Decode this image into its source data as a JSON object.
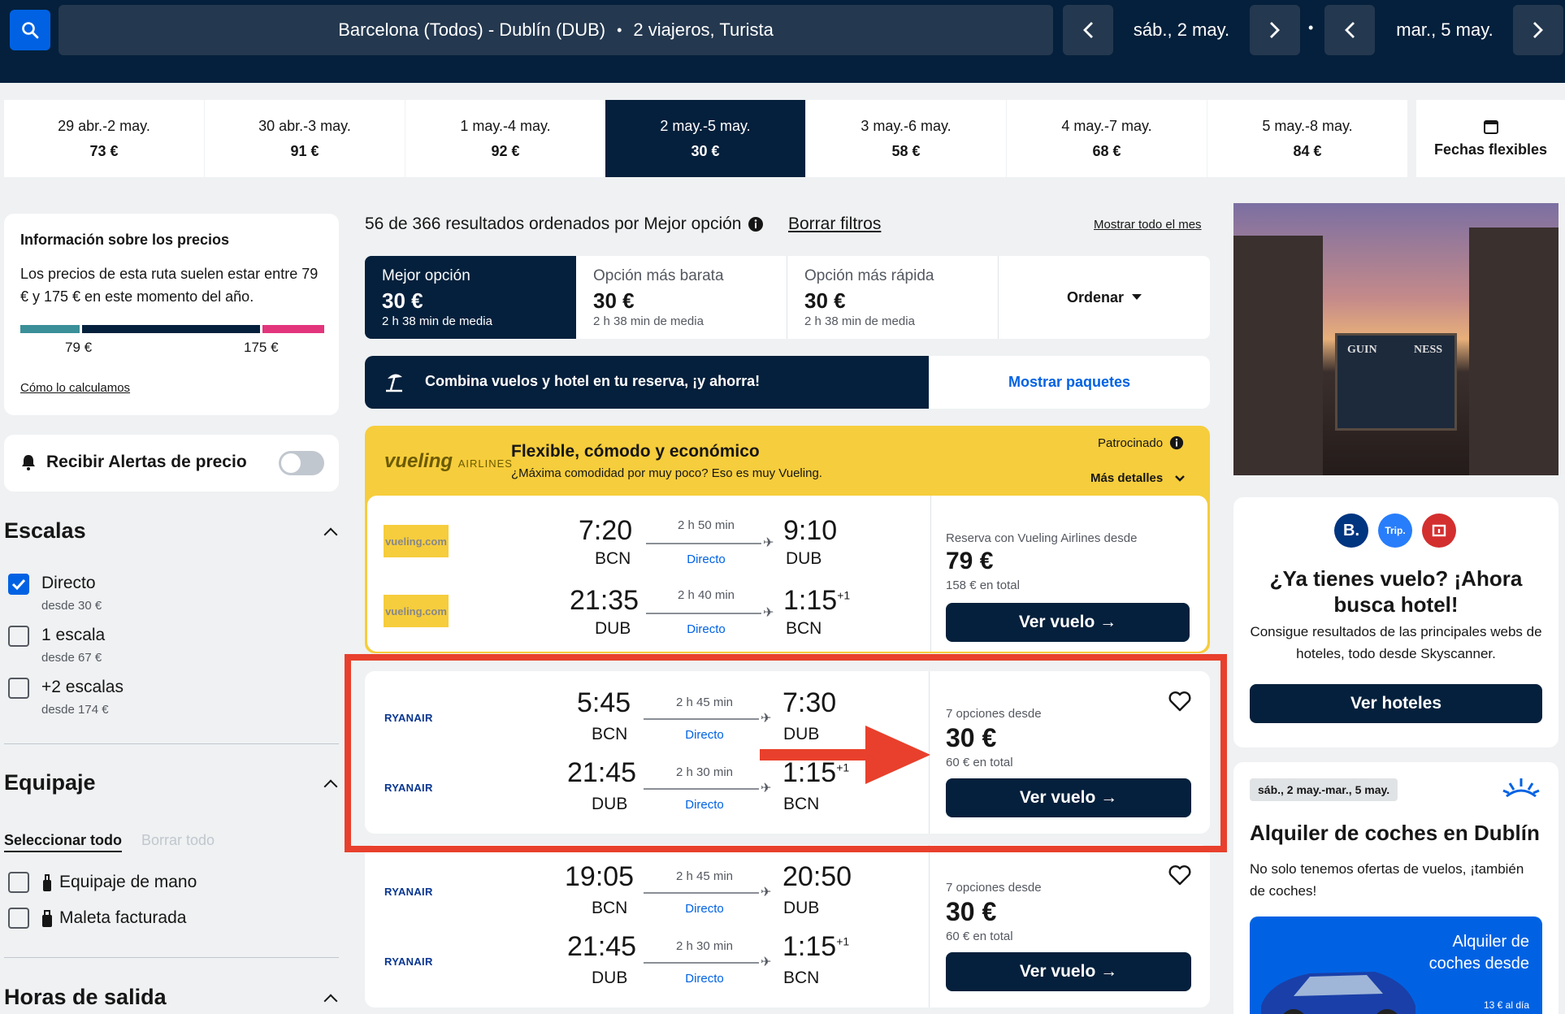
{
  "search": {
    "route": "Barcelona (Todos) - Dublín (DUB)",
    "travellers": "2 viajeros, Turista",
    "depart_date": "sáb., 2 may.",
    "return_date": "mar., 5 may."
  },
  "date_tabs": [
    {
      "range": "29 abr.-2 may.",
      "price": "73 €"
    },
    {
      "range": "30 abr.-3 may.",
      "price": "91 €"
    },
    {
      "range": "1 may.-4 may.",
      "price": "92 €"
    },
    {
      "range": "2 may.-5 may.",
      "price": "30 €"
    },
    {
      "range": "3 may.-6 may.",
      "price": "58 €"
    },
    {
      "range": "4 may.-7 may.",
      "price": "68 €"
    },
    {
      "range": "5 may.-8 may.",
      "price": "84 €"
    }
  ],
  "flexible_dates_label": "Fechas flexibles",
  "price_info": {
    "title": "Información sobre los precios",
    "text": "Los precios de esta ruta suelen estar entre 79 € y 175 € en este momento del año.",
    "low": "79 €",
    "high": "175 €",
    "link": "Cómo lo calculamos"
  },
  "alerts_label": "Recibir Alertas de precio",
  "stops": {
    "title": "Escalas",
    "options": [
      {
        "label": "Directo",
        "sub": "desde 30 €",
        "checked": true
      },
      {
        "label": "1 escala",
        "sub": "desde 67 €",
        "checked": false
      },
      {
        "label": "+2 escalas",
        "sub": "desde 174 €",
        "checked": false
      }
    ]
  },
  "baggage": {
    "title": "Equipaje",
    "select_all": "Seleccionar todo",
    "clear_all": "Borrar todo",
    "options": [
      "Equipaje de mano",
      "Maleta facturada"
    ]
  },
  "departure_times_title": "Horas de salida",
  "results": {
    "summary": "56 de 366 resultados ordenados por Mejor opción",
    "clear_filters": "Borrar filtros",
    "show_month": "Mostrar todo el mes"
  },
  "sort": [
    {
      "title": "Mejor opción",
      "price": "30 €",
      "duration": "2 h 38 min de media"
    },
    {
      "title": "Opción más barata",
      "price": "30 €",
      "duration": "2 h 38 min de media"
    },
    {
      "title": "Opción más rápida",
      "price": "30 €",
      "duration": "2 h 38 min de media"
    }
  ],
  "sort_menu_label": "Ordenar",
  "packages": {
    "text": "Combina vuelos y hotel en tu reserva, ¡y ahorra!",
    "button": "Mostrar paquetes"
  },
  "sponsored": {
    "logo": "vueling",
    "logo_sub": "AIRLINES",
    "title": "Flexible, cómodo y económico",
    "subtitle": "¿Máxima comodidad por muy poco? Eso es muy Vueling.",
    "tag": "Patrocinado",
    "more": "Más detalles",
    "outbound": {
      "dep": "7:20",
      "from": "BCN",
      "duration": "2 h 50 min",
      "type": "Directo",
      "arr": "9:10",
      "to": "DUB"
    },
    "inbound": {
      "dep": "21:35",
      "from": "DUB",
      "duration": "2 h 40 min",
      "type": "Directo",
      "arr": "1:15",
      "plus": "+1",
      "to": "BCN"
    },
    "book_text": "Reserva con Vueling Airlines desde",
    "price": "79 €",
    "total": "158 € en total",
    "button": "Ver vuelo →",
    "carrier_logo": "vueling.com"
  },
  "flights": [
    {
      "airline": "RYANAIR",
      "outbound": {
        "dep": "5:45",
        "from": "BCN",
        "duration": "2 h 45 min",
        "type": "Directo",
        "arr": "7:30",
        "to": "DUB"
      },
      "inbound": {
        "dep": "21:45",
        "from": "DUB",
        "duration": "2 h 30 min",
        "type": "Directo",
        "arr": "1:15",
        "plus": "+1",
        "to": "BCN"
      },
      "options": "7 opciones desde",
      "price": "30 €",
      "total": "60 € en total",
      "button": "Ver vuelo →"
    },
    {
      "airline": "RYANAIR",
      "outbound": {
        "dep": "19:05",
        "from": "BCN",
        "duration": "2 h 45 min",
        "type": "Directo",
        "arr": "20:50",
        "to": "DUB"
      },
      "inbound": {
        "dep": "21:45",
        "from": "DUB",
        "duration": "2 h 30 min",
        "type": "Directo",
        "arr": "1:15",
        "plus": "+1",
        "to": "BCN"
      },
      "options": "7 opciones desde",
      "price": "30 €",
      "total": "60 € en total",
      "button": "Ver vuelo →"
    }
  ],
  "hotel_ad": {
    "badges": [
      "B.",
      "Trip."
    ],
    "title": "¿Ya tienes vuelo? ¡Ahora busca hotel!",
    "text": "Consigue resultados de las principales webs de hoteles, todo desde Skyscanner.",
    "button": "Ver hoteles"
  },
  "promo_image_text": [
    "GUIN",
    "NESS"
  ],
  "car_ad": {
    "dates": "sáb., 2 may.-mar., 5 may.",
    "title": "Alquiler de coches en Dublín",
    "text": "No solo tenemos ofertas de vuelos, ¡también de coches!",
    "card_text": "Alquiler de coches desde",
    "card_sub": "13 € al día"
  },
  "colors": {
    "navy": "#05203c",
    "blue": "#0062e3",
    "yellow": "#f6cd3c",
    "annotation_red": "#e8402c"
  }
}
